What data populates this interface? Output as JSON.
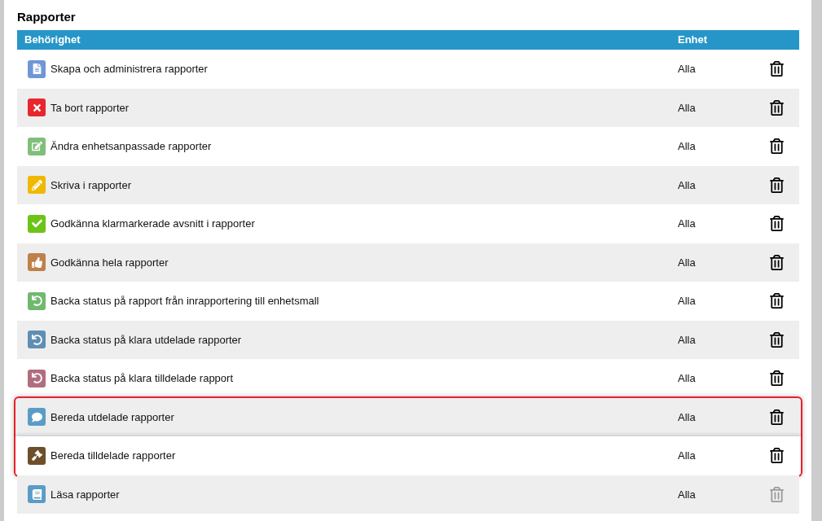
{
  "section_title": "Rapporter",
  "columns": [
    "Behörighet",
    "Enhet"
  ],
  "rows": [
    {
      "kind": "document",
      "color": "#6f97d6",
      "label": "Skapa och administrera rapporter",
      "unit": "Alla",
      "highlighted": false,
      "delete_disabled": false
    },
    {
      "kind": "cross",
      "color": "#e8262d",
      "label": "Ta bort rapporter",
      "unit": "Alla",
      "highlighted": false,
      "delete_disabled": false
    },
    {
      "kind": "edit",
      "color": "#7fbf7a",
      "label": "Ändra enhetsanpassade rapporter",
      "unit": "Alla",
      "highlighted": false,
      "delete_disabled": false
    },
    {
      "kind": "pencil",
      "color": "#f0b800",
      "label": "Skriva i rapporter",
      "unit": "Alla",
      "highlighted": false,
      "delete_disabled": false
    },
    {
      "kind": "check",
      "color": "#6cc417",
      "label": "Godkänna klarmarkerade avsnitt i rapporter",
      "unit": "Alla",
      "highlighted": false,
      "delete_disabled": false
    },
    {
      "kind": "thumbsup",
      "color": "#c0804a",
      "label": "Godkänna hela rapporter",
      "unit": "Alla",
      "highlighted": false,
      "delete_disabled": false
    },
    {
      "kind": "undo",
      "color": "#72b86e",
      "label": "Backa status på rapport från inrapportering till enhetsmall",
      "unit": "Alla",
      "highlighted": false,
      "delete_disabled": false
    },
    {
      "kind": "undo",
      "color": "#5e8fb5",
      "label": "Backa status på klara utdelade rapporter",
      "unit": "Alla",
      "highlighted": false,
      "delete_disabled": false
    },
    {
      "kind": "undo",
      "color": "#b06e80",
      "label": "Backa status på klara tilldelade rapport",
      "unit": "Alla",
      "highlighted": false,
      "delete_disabled": false
    },
    {
      "kind": "comment",
      "color": "#5b9cc7",
      "label": "Bereda utdelade rapporter",
      "unit": "Alla",
      "highlighted": true,
      "delete_disabled": false
    },
    {
      "kind": "gavel",
      "color": "#6f4f2a",
      "label": "Bereda tilldelade rapporter",
      "unit": "Alla",
      "highlighted": true,
      "delete_disabled": false
    },
    {
      "kind": "book",
      "color": "#5b9cc7",
      "label": "Läsa rapporter",
      "unit": "Alla",
      "highlighted": false,
      "delete_disabled": true
    }
  ]
}
